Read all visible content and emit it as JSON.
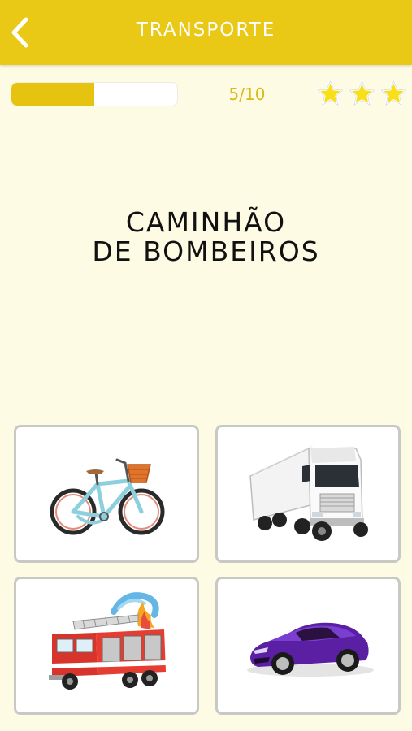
{
  "header": {
    "title": "TRANSPORTE",
    "back_icon": "chevron-left-icon"
  },
  "progress": {
    "current": 5,
    "total": 10,
    "label": "5/10",
    "fill_fraction": 0.5
  },
  "stars": {
    "count": 3,
    "icon": "star-icon"
  },
  "prompt": {
    "line1": "CAMINHÃO",
    "line2": "DE BOMBEIROS"
  },
  "options": [
    {
      "image": "bicycle-image"
    },
    {
      "image": "semi-truck-image"
    },
    {
      "image": "fire-truck-image"
    },
    {
      "image": "sports-car-image"
    }
  ],
  "colors": {
    "header": "#eac816",
    "background": "#fdfbe4",
    "progress_fill": "#e5c30f",
    "star_fill": "#f7df1a",
    "card_border": "#c8c8c5"
  }
}
